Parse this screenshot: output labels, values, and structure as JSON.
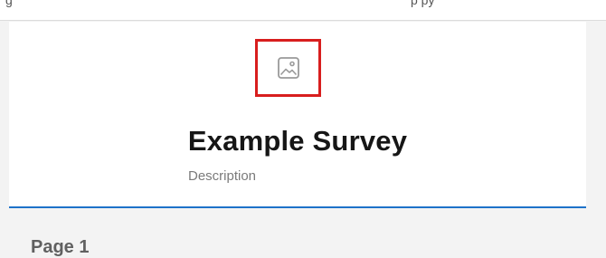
{
  "top_bar": {
    "left_text": "g",
    "right_text": "p      py"
  },
  "survey": {
    "title": "Example Survey",
    "description": "Description",
    "logo_icon": "image-placeholder-icon",
    "logo_highlight_color": "#d81e1e",
    "accent_color": "#1e73c9"
  },
  "page": {
    "title": "Page 1"
  }
}
